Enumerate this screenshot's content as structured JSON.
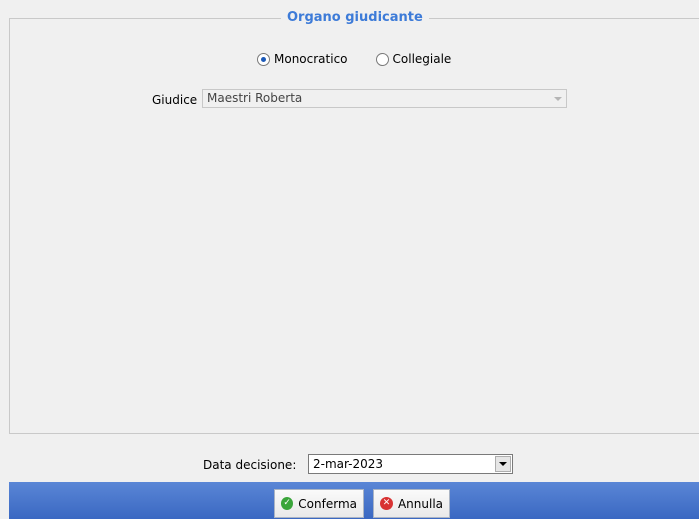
{
  "organo": {
    "title": "Organo giudicante",
    "options": [
      {
        "label": "Monocratico",
        "selected": true
      },
      {
        "label": "Collegiale",
        "selected": false
      }
    ]
  },
  "giudice": {
    "label": "Giudice",
    "value": "Maestri Roberta"
  },
  "decisione": {
    "label": "Data decisione:",
    "value": "2-mar-2023"
  },
  "actions": {
    "confirm_label": "Conferma",
    "cancel_label": "Annulla",
    "confirm_icon": "check-icon",
    "cancel_icon": "x-icon"
  },
  "colors": {
    "legend": "#3d7bd8",
    "bar": "#4a78cc"
  }
}
